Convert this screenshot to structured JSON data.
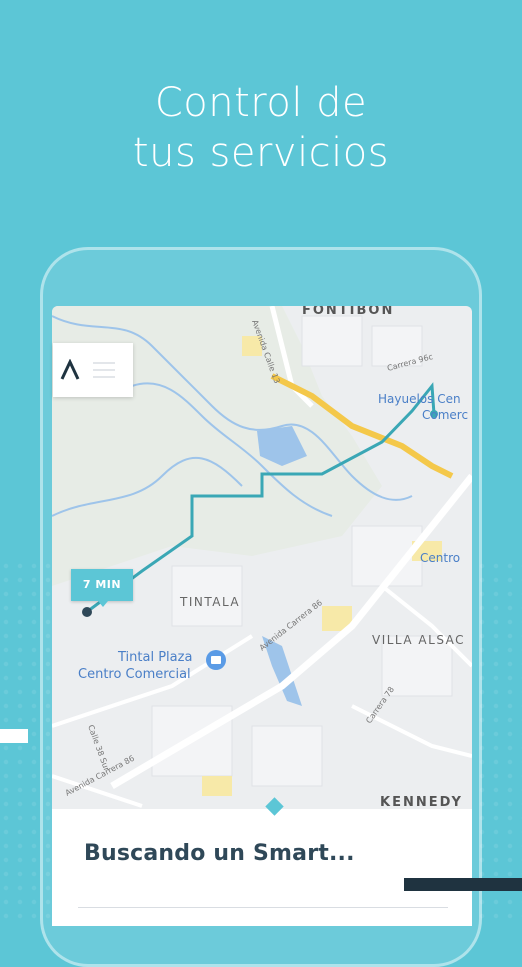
{
  "headline": {
    "line1": "Control de",
    "line2": "tus servicios"
  },
  "map": {
    "labels": {
      "fontibon": "FONTIBON",
      "hayuelos": "Hayuelos Cen",
      "comercial_top": "Comerc",
      "centro_right": "Centro",
      "tintala": "TINTALA",
      "villa_alsacia": "VILLA ALSAC",
      "kennedy": "KENNEDY",
      "tintal_plaza": "Tintal Plaza",
      "centro_comercial": "Centro Comercial",
      "calle13": "Avenida Calle 13",
      "carrera86": "Avenida Carrera 86",
      "carrera86_bottom": "Avenida Carrera 86",
      "carrera78": "Carrera 78",
      "carrera96": "Carrera 96c",
      "calle38": "Calle 38 Sur"
    },
    "eta_badge": "7 MIN"
  },
  "sheet": {
    "title": "Buscando un Smart..."
  },
  "colors": {
    "accent": "#5cc6d6",
    "route": "#3aa7b5",
    "dark": "#2f4858"
  },
  "icons": {
    "logo": "brand-logo-icon",
    "menu": "hamburger-menu-icon",
    "place": "shopping-bag-pin-icon"
  }
}
